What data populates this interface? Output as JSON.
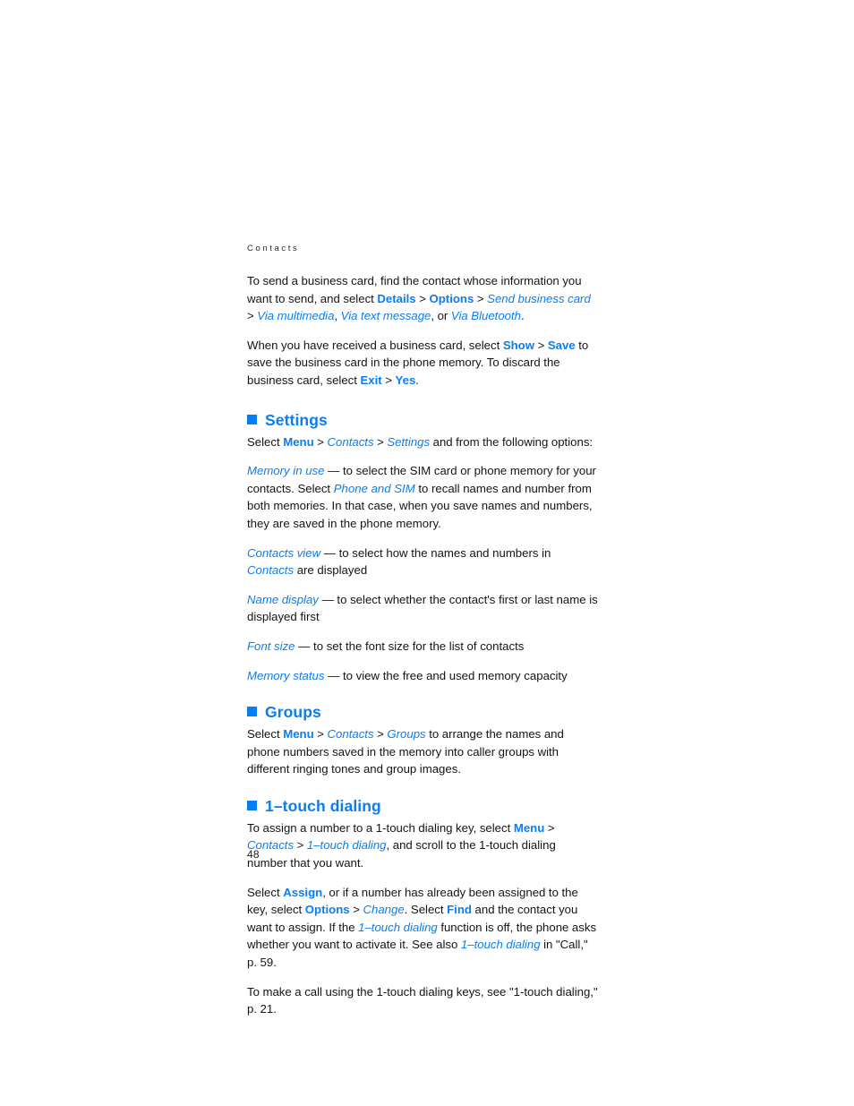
{
  "document": {
    "running_head": "Contacts",
    "page_number": "48",
    "accent_color": "#0b7df2",
    "text_color": "#141414",
    "background_color": "#ffffff"
  },
  "intro": {
    "para1": {
      "t1": "To send a business card, find the contact whose information you want to send, and select ",
      "term1": "Details",
      "sep1": " > ",
      "term2": "Options",
      "sep2": " > ",
      "term3": "Send business card",
      "sep3": " > ",
      "term4": "Via multimedia",
      "t2": ", ",
      "term5": "Via text message",
      "t3": ", or ",
      "term6": "Via Bluetooth",
      "t4": "."
    },
    "para2": {
      "t1": "When you have received a business card, select ",
      "term1": "Show",
      "sep1": " > ",
      "term2": "Save",
      "t2": " to save the business card in the phone memory. To discard the business card, select ",
      "term3": "Exit",
      "sep2": " > ",
      "term4": "Yes",
      "t3": "."
    }
  },
  "settings": {
    "heading": "Settings",
    "intro": {
      "t1": "Select ",
      "term1": "Menu",
      "sep1": " > ",
      "term2": "Contacts",
      "sep2": " > ",
      "term3": "Settings",
      "t2": " and from the following options:"
    },
    "options": [
      {
        "name": "Memory in use",
        "dash": " — ",
        "desc_1": "to select the SIM card or phone memory for your contacts. Select ",
        "inline_term": "Phone and SIM",
        "desc_2": " to recall names and number from both memories. In that case, when you save names and numbers, they are saved in the phone memory."
      },
      {
        "name": "Contacts view",
        "dash": " — ",
        "desc_1": "to select how the names and numbers in ",
        "inline_term": "Contacts",
        "desc_2": " are displayed"
      },
      {
        "name": "Name display",
        "dash": " — ",
        "desc_1": "to select whether the contact's first or last name is displayed first",
        "inline_term": "",
        "desc_2": ""
      },
      {
        "name": "Font size",
        "dash": " — ",
        "desc_1": "to set the font size for the list of contacts",
        "inline_term": "",
        "desc_2": ""
      },
      {
        "name": "Memory status",
        "dash": " — ",
        "desc_1": "to view the free and used memory capacity",
        "inline_term": "",
        "desc_2": ""
      }
    ]
  },
  "groups": {
    "heading": "Groups",
    "para": {
      "t1": "Select ",
      "term1": "Menu",
      "sep1": " > ",
      "term2": "Contacts",
      "sep2": " > ",
      "term3": "Groups",
      "t2": " to arrange the names and phone numbers saved in the memory into caller groups with different ringing tones and group images."
    }
  },
  "one_touch": {
    "heading": "1–touch dialing",
    "para1": {
      "t1": "To assign a number to a 1-touch dialing key, select ",
      "term1": "Menu",
      "sep1": " > ",
      "term2": "Contacts",
      "sep2": " > ",
      "term3": "1–touch dialing",
      "t2": ", and scroll to the 1-touch dialing number that you want."
    },
    "para2": {
      "t1": "Select ",
      "term1": "Assign",
      "t2": ", or if a number has already been assigned to the key, select ",
      "term2": "Options",
      "sep1": " > ",
      "term3": "Change",
      "t3": ". Select ",
      "term4": "Find",
      "t4": " and the contact you want to assign. If the ",
      "term5": "1–touch dialing",
      "t5": " function is off, the phone asks whether you want to activate it. See also ",
      "term6": "1–touch dialing",
      "t6": " in \"Call,\" p. 59."
    },
    "para3": "To make a call using the 1-touch dialing keys, see \"1-touch dialing,\" p. 21."
  }
}
